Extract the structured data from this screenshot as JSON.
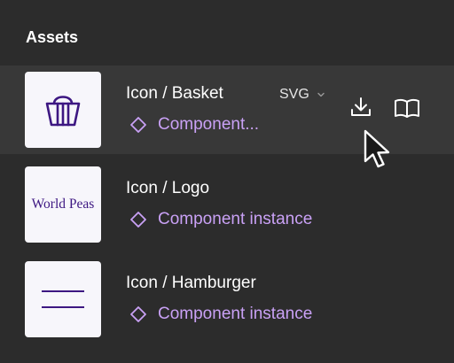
{
  "panel": {
    "title": "Assets"
  },
  "colors": {
    "background": "#2c2c2c",
    "row_highlight": "#383838",
    "thumbnail_bg": "#f7f6fb",
    "component_accent": "#c9a1f5",
    "brand_purple": "#3d1782"
  },
  "assets": [
    {
      "name": "Icon / Basket",
      "type_label": "Component...",
      "type_icon": "component-instance-icon",
      "thumbnail_icon": "basket-icon",
      "hovered": true,
      "actions": {
        "format_value": "SVG",
        "format_icon": "chevron-down-icon",
        "download_icon": "download-icon",
        "docs_icon": "open-book-icon"
      }
    },
    {
      "name": "Icon / Logo",
      "type_label": "Component instance",
      "type_icon": "component-instance-icon",
      "thumbnail_text": "World Peas"
    },
    {
      "name": "Icon / Hamburger",
      "type_label": "Component instance",
      "type_icon": "component-instance-icon",
      "thumbnail_icon": "hamburger-icon"
    }
  ],
  "cursor_icon": "mouse-pointer-icon"
}
